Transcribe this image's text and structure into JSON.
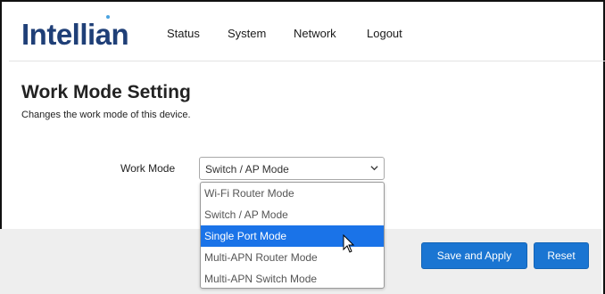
{
  "header": {
    "brand": "Intellian",
    "nav": [
      "Status",
      "System",
      "Network",
      "Logout"
    ]
  },
  "page": {
    "title": "Work Mode Setting",
    "subtitle": "Changes the work mode of this device."
  },
  "form": {
    "work_mode_label": "Work Mode",
    "work_mode_value": "Switch / AP Mode",
    "options": [
      "Wi-Fi Router Mode",
      "Switch / AP Mode",
      "Single Port Mode",
      "Multi-APN Router Mode",
      "Multi-APN Switch Mode"
    ],
    "highlighted_option": "Single Port Mode"
  },
  "actions": {
    "save_label": "Save and Apply",
    "reset_label": "Reset"
  },
  "colors": {
    "brand": "#1f3f77",
    "accent": "#1a75d2",
    "highlight": "#1a73e8"
  },
  "icons": [
    "chevron-down-icon",
    "mouse-cursor-icon"
  ]
}
